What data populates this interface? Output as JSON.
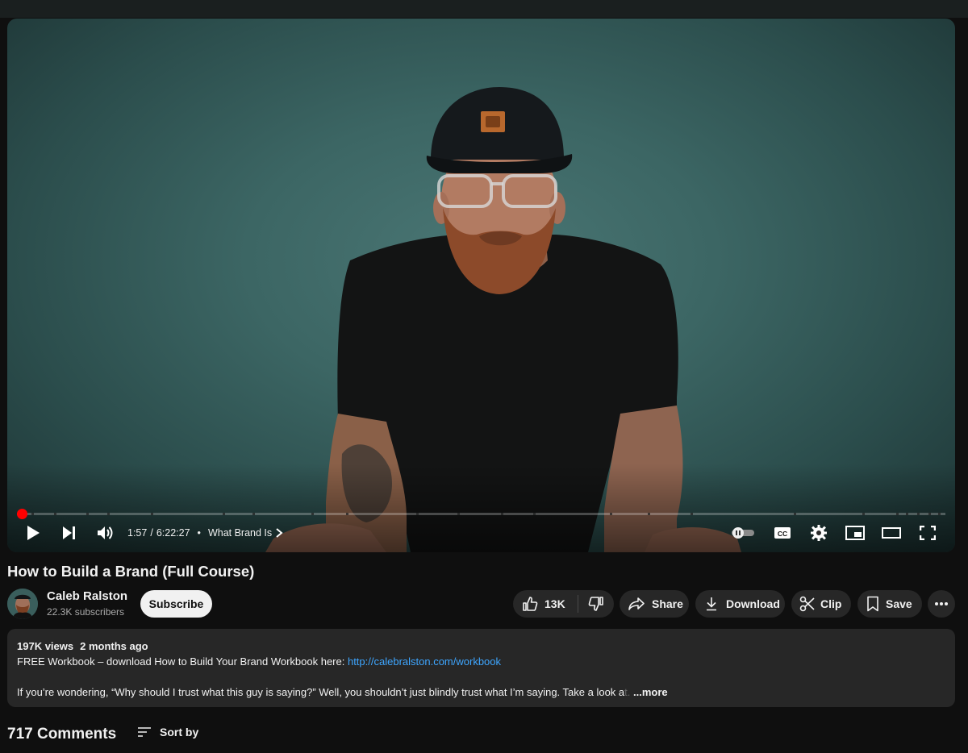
{
  "player": {
    "current_time": "1:57",
    "duration": "6:22:27",
    "chapter": "What Brand Is",
    "progress_fraction": 0.0051,
    "accent_color": "#ff0000",
    "icons": [
      "play-icon",
      "next-icon",
      "volume-icon",
      "chevron-right-icon",
      "autoplay-toggle-icon",
      "captions-icon",
      "settings-icon",
      "miniplayer-icon",
      "theater-mode-icon",
      "fullscreen-icon"
    ],
    "captions_label": "CC"
  },
  "video": {
    "title": "How to Build a Brand (Full Course)"
  },
  "channel": {
    "name": "Caleb Ralston",
    "subscribers": "22.3K subscribers",
    "subscribe_label": "Subscribe"
  },
  "actions": {
    "likes": "13K",
    "share_label": "Share",
    "download_label": "Download",
    "clip_label": "Clip",
    "save_label": "Save"
  },
  "description": {
    "views": "197K views",
    "age": "2 months ago",
    "line1_text": "FREE Workbook – download How to Build Your Brand Workbook here: ",
    "line1_link": "http://calebralston.com/workbook",
    "line3_text": "If you’re wondering, “Why should I trust what this guy is saying?” Well, you shouldn’t just blindly trust what I’m saying. Take a look a",
    "line3_fade": "t.",
    "more_label": "...more"
  },
  "comments": {
    "count_label": "717 Comments",
    "sort_label": "Sort by"
  }
}
